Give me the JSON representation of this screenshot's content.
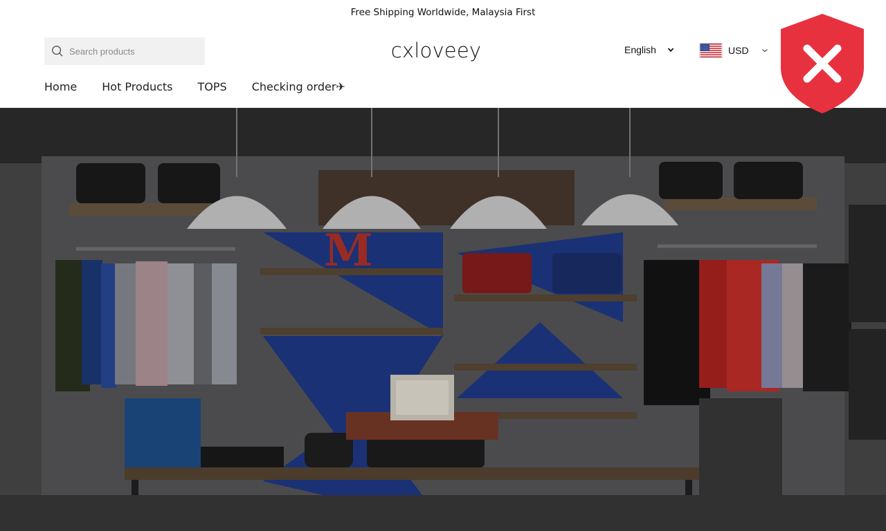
{
  "announcement": {
    "text": "Free Shipping Worldwide, Malaysia First"
  },
  "header": {
    "search": {
      "placeholder": "Search products",
      "icon": "search-icon"
    },
    "logo": "cxloveey",
    "language": {
      "selected": "English",
      "icon": "chevron-down-icon"
    },
    "currency": {
      "selected": "USD",
      "flag": "us-flag-icon",
      "icon": "chevron-down-icon"
    },
    "security_badge": {
      "icon": "shield-x-icon",
      "color": "#e8313f"
    }
  },
  "nav": {
    "items": [
      {
        "label": "Home"
      },
      {
        "label": "Hot Products"
      },
      {
        "label": "TOPS"
      },
      {
        "label": "Checking order✈"
      }
    ]
  },
  "hero": {
    "image": "clothing-store-interior"
  }
}
